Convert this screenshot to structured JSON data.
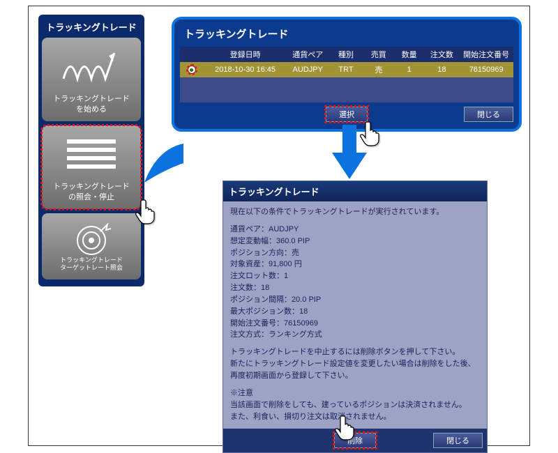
{
  "sidebar": {
    "title": "トラッキングトレード",
    "cards": [
      {
        "label": "トラッキングトレード\nを始める"
      },
      {
        "label": "トラッキングトレード\nの照会・停止"
      },
      {
        "label": "トラッキングトレード\nターゲットレート照会"
      }
    ]
  },
  "dialog1": {
    "title": "トラッキングトレード",
    "headers": {
      "date": "登録日時",
      "pair": "通貨ペア",
      "kind": "種別",
      "bs": "売買",
      "qty": "数量",
      "orders": "注文数",
      "startno": "開始注文番号"
    },
    "row": {
      "date": "2018-10-30 16:45",
      "pair": "AUDJPY",
      "kind": "TRT",
      "bs": "売",
      "qty": "1",
      "orders": "18",
      "startno": "76150969"
    },
    "select_btn": "選択",
    "close_btn": "閉じる"
  },
  "dialog2": {
    "title": "トラッキングトレード",
    "intro": "現在以下の条件でトラッキングトレードが実行されています。",
    "lines": [
      "通貨ペア：AUDJPY",
      "想定変動幅：360.0 PIP",
      "ポジション方向：売",
      "対象資産：91,800 円",
      "注文ロット数：1",
      "注文数：18",
      "ポジション間隔：20.0 PIP",
      "最大ポジション数：18",
      "開始注文番号：76150969",
      "注文方式：ランキング方式"
    ],
    "note1": "トラッキングトレードを中止するには削除ボタンを押して下さい。",
    "note2": "新たにトラッキングトレード設定値を変更したい場合は削除をした後、",
    "note3": "再度初期画面から登録して下さい。",
    "warn_title": "※注意",
    "warn1": "当該画面で削除をしても、建っているポジションは決済されません。",
    "warn2": "また、利食い、損切り注文は取消されません。",
    "delete_btn": "削除",
    "close_btn": "閉じる"
  }
}
